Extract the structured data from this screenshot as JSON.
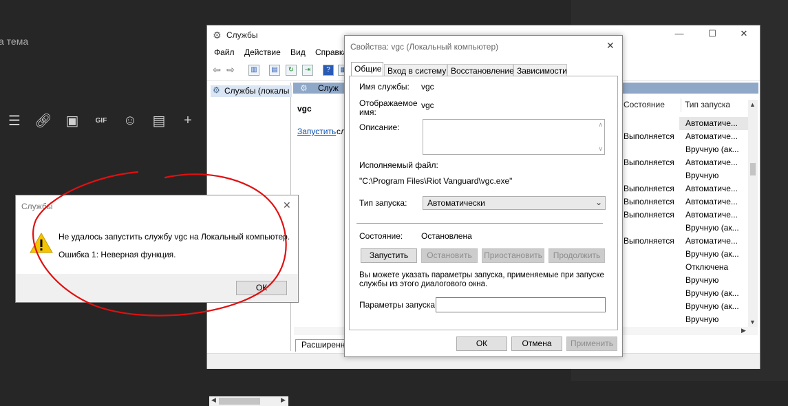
{
  "background": {
    "topic_text": "а тема",
    "toolbar_icons": [
      "list-icon",
      "link-icon",
      "image-icon",
      "gif-icon",
      "smiley-icon",
      "gallery-icon",
      "plus-icon",
      "more-icon"
    ],
    "gif_label": "GIF"
  },
  "services_window": {
    "title": "Службы",
    "menu": [
      "Файл",
      "Действие",
      "Вид",
      "Справка"
    ],
    "tree_item": "Службы (локалы",
    "detail_header": "Служ",
    "selected_service": "vgc",
    "start_link": "Запустить",
    "start_link_rest": "сл",
    "columns": {
      "state": "Состояние",
      "startup": "Тип запуска"
    },
    "rows": [
      {
        "state": "",
        "startup": "Автоматиче..."
      },
      {
        "state": "Выполняется",
        "startup": "Автоматиче..."
      },
      {
        "state": "",
        "startup": "Вручную (ак..."
      },
      {
        "state": "Выполняется",
        "startup": "Автоматиче..."
      },
      {
        "state": "",
        "startup": "Вручную"
      },
      {
        "state": "Выполняется",
        "startup": "Автоматиче..."
      },
      {
        "state": "Выполняется",
        "startup": "Автоматиче..."
      },
      {
        "state": "Выполняется",
        "startup": "Автоматиче..."
      },
      {
        "state": "",
        "startup": "Вручную (ак..."
      },
      {
        "state": "Выполняется",
        "startup": "Автоматиче..."
      },
      {
        "state": "",
        "startup": "Вручную (ак..."
      },
      {
        "state": "",
        "startup": "Отключена"
      },
      {
        "state": "",
        "startup": "Вручную"
      },
      {
        "state": "",
        "startup": "Вручную (ак..."
      },
      {
        "state": "",
        "startup": "Вручную (ак..."
      },
      {
        "state": "",
        "startup": "Вручную"
      }
    ],
    "extended_tab": "Расширенн"
  },
  "properties_dialog": {
    "title": "Свойства: vgc (Локальный компьютер)",
    "tabs": [
      "Общие",
      "Вход в систему",
      "Восстановление",
      "Зависимости"
    ],
    "service_name_label": "Имя службы:",
    "service_name_value": "vgc",
    "display_name_label_1": "Отображаемое",
    "display_name_label_2": "имя:",
    "display_name_value": "vgc",
    "description_label": "Описание:",
    "exe_label": "Исполняемый файл:",
    "exe_path": "\"C:\\Program Files\\Riot Vanguard\\vgc.exe\"",
    "startup_type_label": "Тип запуска:",
    "startup_type_value": "Автоматически",
    "state_label": "Состояние:",
    "state_value": "Остановлена",
    "buttons": {
      "start": "Запустить",
      "stop": "Остановить",
      "pause": "Приостановить",
      "resume": "Продолжить"
    },
    "hint_1": "Вы можете указать параметры запуска, применяемые при запуске",
    "hint_2": "службы из этого диалогового окна.",
    "params_label": "Параметры запуска:",
    "params_value": "",
    "footer": {
      "ok": "ОК",
      "cancel": "Отмена",
      "apply": "Применить"
    }
  },
  "error_dialog": {
    "title": "Службы",
    "message": "Не удалось запустить службу vgc на Локальный компьютер.",
    "error": "Ошибка 1: Неверная функция.",
    "ok": "ОК"
  },
  "colors": {
    "annotation": "#e01010",
    "warning": "#f5c400",
    "header_band": "#8fa8c8"
  }
}
